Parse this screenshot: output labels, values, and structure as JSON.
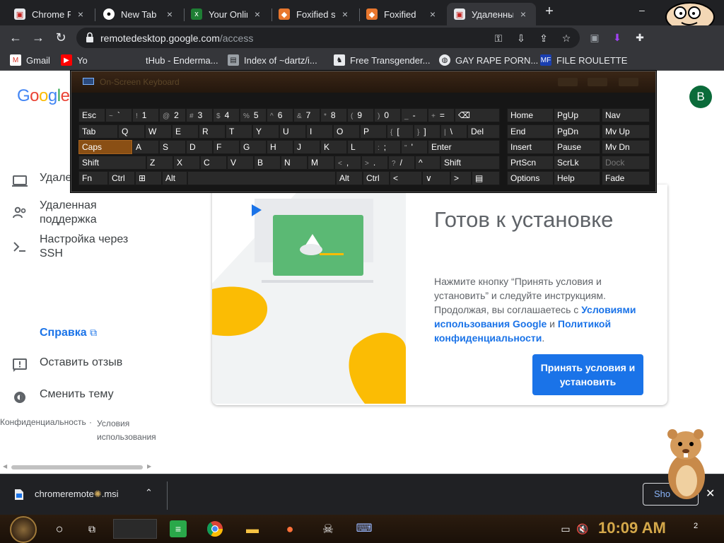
{
  "tabs": [
    {
      "title": "Chrome Re",
      "icon": "chrome-remote-icon"
    },
    {
      "title": "New Tab",
      "icon": "github-icon"
    },
    {
      "title": "Your Onlin",
      "icon": "sheet-icon"
    },
    {
      "title": "Foxified s",
      "icon": "fox-icon"
    },
    {
      "title": "Foxified",
      "icon": "fox-icon"
    },
    {
      "title": "Удаленны",
      "icon": "chrome-remote-icon"
    }
  ],
  "window_controls": {
    "minimize": "–",
    "new_tab": "+"
  },
  "omnibox": {
    "host": "remotedesktop.google.com",
    "path": "/access"
  },
  "bookmarks": [
    {
      "label": "Gmail",
      "icon": "gmail-icon"
    },
    {
      "label": "Yo",
      "icon": "youtube-icon"
    },
    {
      "label": "tHub - Enderma...",
      "icon": "github-icon"
    },
    {
      "label": "Index of ~dartz/i...",
      "icon": "page-icon"
    },
    {
      "label": "Free Transgender...",
      "icon": "page-icon"
    },
    {
      "label": "GAY RAPE PORN...",
      "icon": "globe-icon"
    },
    {
      "label": "FILE ROULETTE",
      "icon": "mf-icon"
    }
  ],
  "page": {
    "logo": "Google",
    "account_initial": "B",
    "nav": [
      {
        "label": "Удале",
        "icon": "laptop-icon"
      },
      {
        "label": "Удаленная поддержка",
        "icon": "people-icon"
      },
      {
        "label": "Настройка через SSH",
        "icon": "terminal-icon"
      }
    ],
    "help": "Справка",
    "feedback": "Оставить отзыв",
    "theme": "Сменить тему",
    "footer_privacy": "Конфиденциальность",
    "footer_dot": "·",
    "footer_terms": "Условия использования"
  },
  "dialog": {
    "title": "Готов к установке",
    "body_1": "Нажмите кнопку “Принять условия и установить” и следуйте инструкциям. Продолжая, вы соглашаетесь с ",
    "link_terms": "Условиями использования Google",
    "body_2": " и ",
    "link_privacy": "Политикой конфиденциальности",
    "body_3": ".",
    "button": "Принять условия и установить"
  },
  "keyboard": {
    "title": "On-Screen Keyboard",
    "row1": [
      {
        "label": "Esc"
      },
      {
        "sub": "~",
        "label": "`"
      },
      {
        "sub": "!",
        "label": "1"
      },
      {
        "sub": "@",
        "label": "2"
      },
      {
        "sub": "#",
        "label": "3"
      },
      {
        "sub": "$",
        "label": "4"
      },
      {
        "sub": "%",
        "label": "5"
      },
      {
        "sub": "^",
        "label": "6"
      },
      {
        "sub": "&",
        "label": "7"
      },
      {
        "sub": "*",
        "label": "8"
      },
      {
        "sub": "(",
        "label": "9"
      },
      {
        "sub": ")",
        "label": "0"
      },
      {
        "sub": "_",
        "label": "-"
      },
      {
        "sub": "+",
        "label": "="
      },
      {
        "label": "⌫"
      }
    ],
    "row2": [
      {
        "label": "Tab"
      },
      {
        "label": "Q"
      },
      {
        "label": "W"
      },
      {
        "label": "E"
      },
      {
        "label": "R"
      },
      {
        "label": "T"
      },
      {
        "label": "Y"
      },
      {
        "label": "U"
      },
      {
        "label": "I"
      },
      {
        "label": "O"
      },
      {
        "label": "P"
      },
      {
        "sub": "{",
        "label": "["
      },
      {
        "sub": "}",
        "label": "]"
      },
      {
        "sub": "|",
        "label": "\\"
      },
      {
        "label": "Del"
      }
    ],
    "row3": [
      {
        "label": "Caps"
      },
      {
        "label": "A"
      },
      {
        "label": "S"
      },
      {
        "label": "D"
      },
      {
        "label": "F"
      },
      {
        "label": "G"
      },
      {
        "label": "H"
      },
      {
        "label": "J"
      },
      {
        "label": "K"
      },
      {
        "label": "L"
      },
      {
        "sub": ":",
        "label": ";"
      },
      {
        "sub": "\"",
        "label": "'"
      },
      {
        "label": "Enter"
      }
    ],
    "row4": [
      {
        "label": "Shift"
      },
      {
        "label": "Z"
      },
      {
        "label": "X"
      },
      {
        "label": "C"
      },
      {
        "label": "V"
      },
      {
        "label": "B"
      },
      {
        "label": "N"
      },
      {
        "label": "M"
      },
      {
        "sub": "<",
        "label": ","
      },
      {
        "sub": ">",
        "label": "."
      },
      {
        "sub": "?",
        "label": "/"
      },
      {
        "label": "^"
      },
      {
        "label": "Shift"
      }
    ],
    "row5": [
      {
        "label": "Fn"
      },
      {
        "label": "Ctrl"
      },
      {
        "label": "⊞"
      },
      {
        "label": "Alt"
      },
      {
        "label": ""
      },
      {
        "label": "Alt"
      },
      {
        "label": "Ctrl"
      },
      {
        "label": "<"
      },
      {
        "label": "∨"
      },
      {
        "label": ">"
      },
      {
        "label": "▤"
      }
    ],
    "nav_col1": [
      "Home",
      "End",
      "Insert",
      "PrtScn",
      "Options"
    ],
    "nav_col2": [
      "PgUp",
      "PgDn",
      "Pause",
      "ScrLk",
      "Help"
    ],
    "nav_col3": [
      "Nav",
      "Mv Up",
      "Mv Dn",
      "Dock",
      "Fade"
    ]
  },
  "download": {
    "filename": "chromeremote",
    "filename_ext": ".msi",
    "show_all": "Sho"
  },
  "taskbar": {
    "clock": "10:09 AM",
    "notifications": "2"
  },
  "colors": {
    "accent": "#1a73e8",
    "chrome_dark": "#202124",
    "caps_key": "#8a4f14"
  }
}
